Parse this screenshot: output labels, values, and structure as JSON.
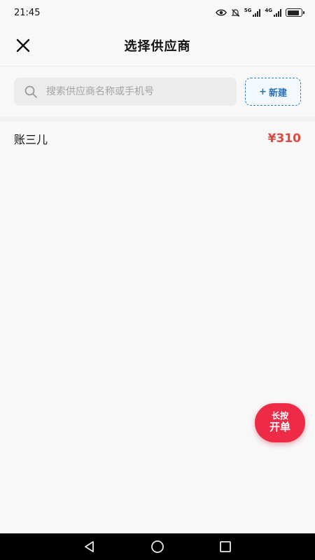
{
  "status_bar": {
    "time": "21:45",
    "network_1": "5G",
    "network_2": "4G",
    "icons": [
      "eye-icon",
      "mute-bell-icon",
      "signal-icon",
      "signal-icon",
      "battery-icon"
    ],
    "battery_level": 0.85
  },
  "header": {
    "title": "选择供应商",
    "close_icon": "close-icon"
  },
  "search": {
    "placeholder": "搜索供应商名称或手机号",
    "value": "",
    "icon": "search-icon"
  },
  "new_button": {
    "plus": "+",
    "label": "新建"
  },
  "suppliers": [
    {
      "name": "账三儿",
      "amount": "¥310"
    }
  ],
  "fab": {
    "line1": "长按",
    "line2": "开单"
  },
  "nav_bar": {
    "icons": [
      "back-icon",
      "home-icon",
      "recents-icon"
    ]
  },
  "colors": {
    "accent_blue": "#2a72b8",
    "amount_red": "#e0483f",
    "fab_red": "#ee2b47",
    "background": "#f8f8f8"
  }
}
